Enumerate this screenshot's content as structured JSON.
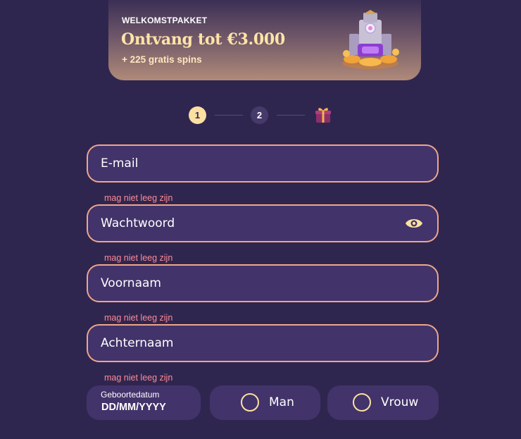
{
  "promo": {
    "kicker": "WELKOMSTPAKKET",
    "headline": "Ontvang tot €3.000",
    "sub": "+ 225 gratis spins"
  },
  "steps": {
    "step1": "1",
    "step2": "2",
    "reward_icon": "gift-icon"
  },
  "form": {
    "email_placeholder": "E-mail",
    "password_placeholder": "Wachtwoord",
    "firstname_placeholder": "Voornaam",
    "lastname_placeholder": "Achternaam",
    "error_required": "mag niet leeg zijn",
    "dob_label": "Geboortedatum",
    "dob_value": "DD/MM/YYYY",
    "gender_male": "Man",
    "gender_female": "Vrouw"
  },
  "colors": {
    "background": "#2f2650",
    "field_background": "#42336a",
    "field_border": "#f1a689",
    "error_text": "#ff8a94",
    "accent": "#fbe0a2"
  }
}
